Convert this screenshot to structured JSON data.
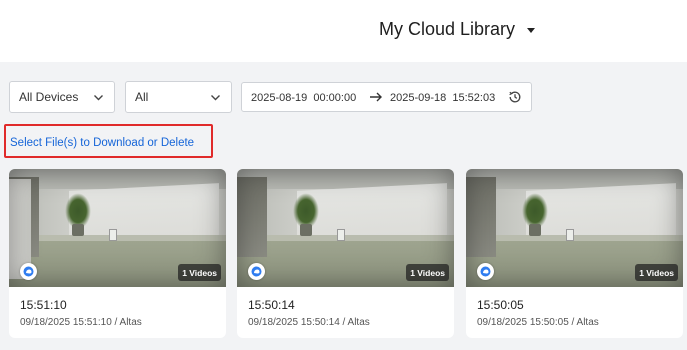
{
  "header": {
    "title": "My Cloud Library"
  },
  "filters": {
    "device": "All Devices",
    "type": "All",
    "start": "2025-08-19  00:00:00",
    "end": "2025-09-18  15:52:03"
  },
  "select_files_label": "Select File(s) to Download or Delete",
  "cards": [
    {
      "badge": "1 Videos",
      "time": "15:51:10",
      "meta": "09/18/2025 15:51:10 / Altas"
    },
    {
      "badge": "1 Videos",
      "time": "15:50:14",
      "meta": "09/18/2025 15:50:14 / Altas"
    },
    {
      "badge": "1 Videos",
      "time": "15:50:05",
      "meta": "09/18/2025 15:50:05 / Altas"
    }
  ],
  "colors": {
    "link": "#1565d8",
    "highlight_border": "#e02a2a",
    "background": "#f2f3f5"
  },
  "icons": [
    "chevron-down-icon",
    "arrow-right-icon",
    "clock-history-icon",
    "cloud-badge-icon"
  ]
}
